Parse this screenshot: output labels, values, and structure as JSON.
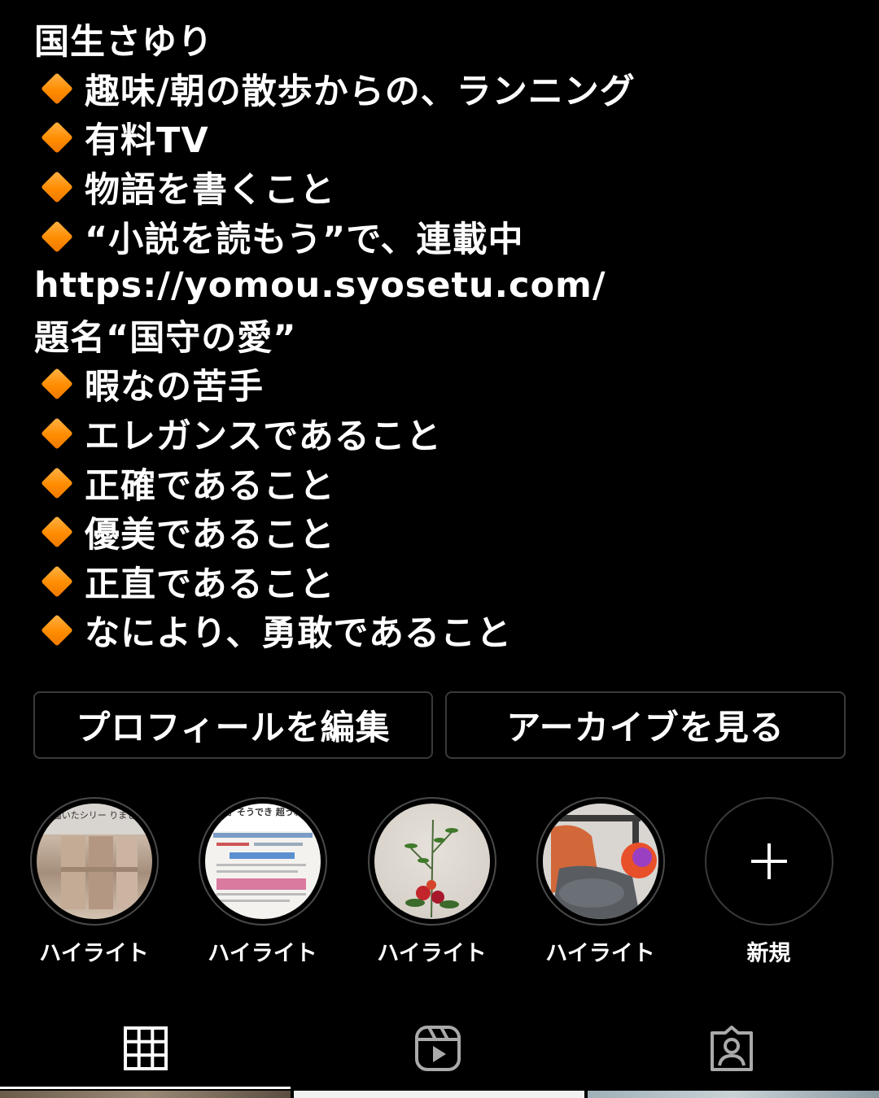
{
  "profile": {
    "name": "国生さゆり",
    "bio_lines": [
      {
        "bullet": true,
        "text": "趣味/朝の散歩からの、ランニング"
      },
      {
        "bullet": true,
        "text": "有料TV"
      },
      {
        "bullet": true,
        "text": "物語を書くこと"
      },
      {
        "bullet": true,
        "text": "“小説を読もう”で、連載中"
      },
      {
        "bullet": false,
        "text": "https://yomou.syosetu.com/"
      },
      {
        "bullet": false,
        "text": "題名“国守の愛”"
      },
      {
        "bullet": true,
        "text": "暇なの苦手"
      },
      {
        "bullet": true,
        "text": "エレガンスであること"
      },
      {
        "bullet": true,
        "text": "正確であること"
      },
      {
        "bullet": true,
        "text": "優美であること"
      },
      {
        "bullet": true,
        "text": "正直であること"
      },
      {
        "bullet": true,
        "text": "なにより、勇敢であること"
      }
    ],
    "bullet_color": "#ff8c00"
  },
  "buttons": {
    "edit_profile": "プロフィールを編集",
    "view_archive": "アーカイブを見る"
  },
  "highlights": [
    {
      "label": "ハイライト",
      "thumb_text": "は届いたシリー りました"
    },
    {
      "label": "ハイライト",
      "thumb_text": "す。そうでき 超うれしい"
    },
    {
      "label": "ハイライト",
      "thumb_text": ""
    },
    {
      "label": "ハイライト",
      "thumb_text": ""
    }
  ],
  "new_highlight": {
    "label": "新規",
    "icon": "plus-icon"
  },
  "tabs": [
    {
      "name": "posts",
      "icon": "grid-icon",
      "active": true
    },
    {
      "name": "reels",
      "icon": "reels-icon",
      "active": false
    },
    {
      "name": "tagged",
      "icon": "tagged-person-icon",
      "active": false
    }
  ]
}
